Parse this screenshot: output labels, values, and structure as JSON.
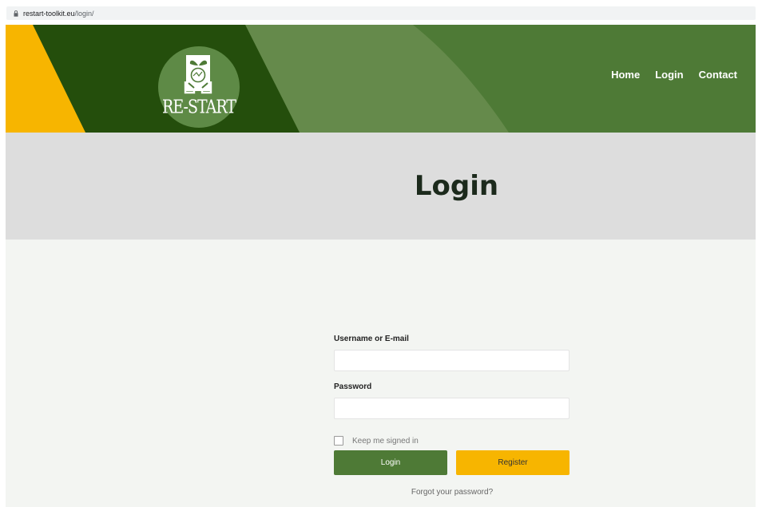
{
  "browser": {
    "url_domain": "restart-toolkit.eu",
    "url_path": "/login/"
  },
  "header": {
    "logo_text": "RE-START",
    "nav": [
      "Home",
      "Login",
      "Contact"
    ]
  },
  "page_title": "Login",
  "form": {
    "username_label": "Username or E-mail",
    "username_value": "",
    "password_label": "Password",
    "password_value": "",
    "keep_signed_in_label": "Keep me signed in",
    "keep_signed_in_checked": false,
    "login_button": "Login",
    "register_button": "Register",
    "forgot_link": "Forgot your password?"
  },
  "colors": {
    "dark_green": "#244e0c",
    "mid_green": "#4e7a36",
    "light_green": "#658a4b",
    "yellow": "#f7b500",
    "title_band": "#dddddd",
    "page_bg": "#f3f5f2"
  },
  "icons": {
    "url_lock": "lock-icon",
    "logo": "sprout-bulb-hands-icon"
  }
}
